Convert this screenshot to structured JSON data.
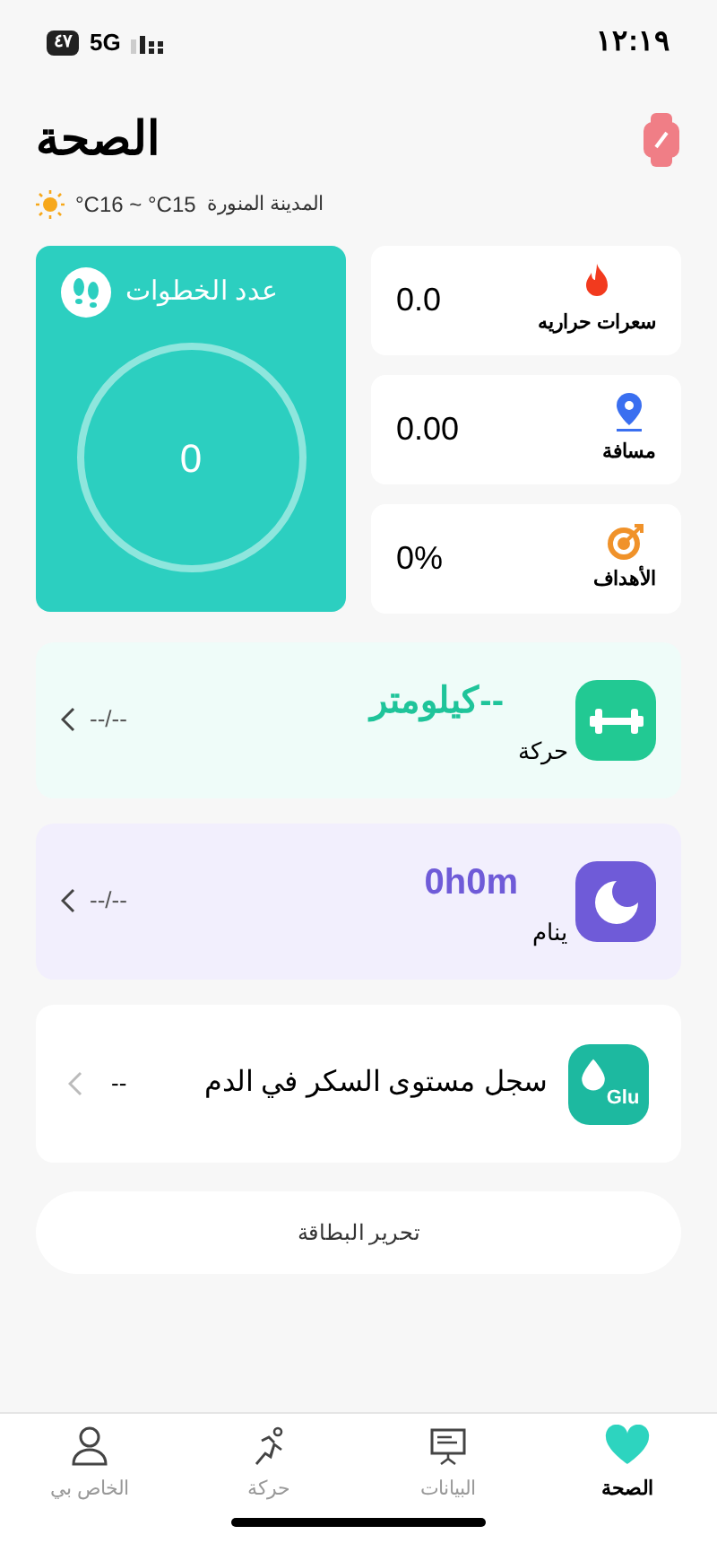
{
  "status_bar": {
    "time": "١٢:١٩",
    "network": "5G",
    "battery": "٤٧"
  },
  "header": {
    "title": "الصحة",
    "city": "المدينة المنورة",
    "temperature": "°C16 ~ °C15"
  },
  "steps": {
    "title": "عدد الخطوات",
    "value": "0"
  },
  "stats": [
    {
      "kind": "calories",
      "label": "سعرات حراريه",
      "value": "0.0"
    },
    {
      "kind": "distance",
      "label": "مسافة",
      "value": "0.00"
    },
    {
      "kind": "goals",
      "label": "الأهداف",
      "value": "0%"
    }
  ],
  "cards": [
    {
      "kind": "activity",
      "label": "حركة",
      "value": "--كيلومتر",
      "time": "--/--"
    },
    {
      "kind": "sleep",
      "label": "ينام",
      "value": "0h0m",
      "time": "--/--"
    }
  ],
  "glucose": {
    "badge": "Glu",
    "title": "سجل مستوى السكر في الدم",
    "value": "--"
  },
  "edit_button": "تحرير البطاقة",
  "tabs": [
    {
      "kind": "health",
      "label": "الصحة",
      "selected": true
    },
    {
      "kind": "data",
      "label": "البيانات",
      "selected": false
    },
    {
      "kind": "activity",
      "label": "حركة",
      "selected": false
    },
    {
      "kind": "profile",
      "label": "الخاص بي",
      "selected": false
    }
  ]
}
